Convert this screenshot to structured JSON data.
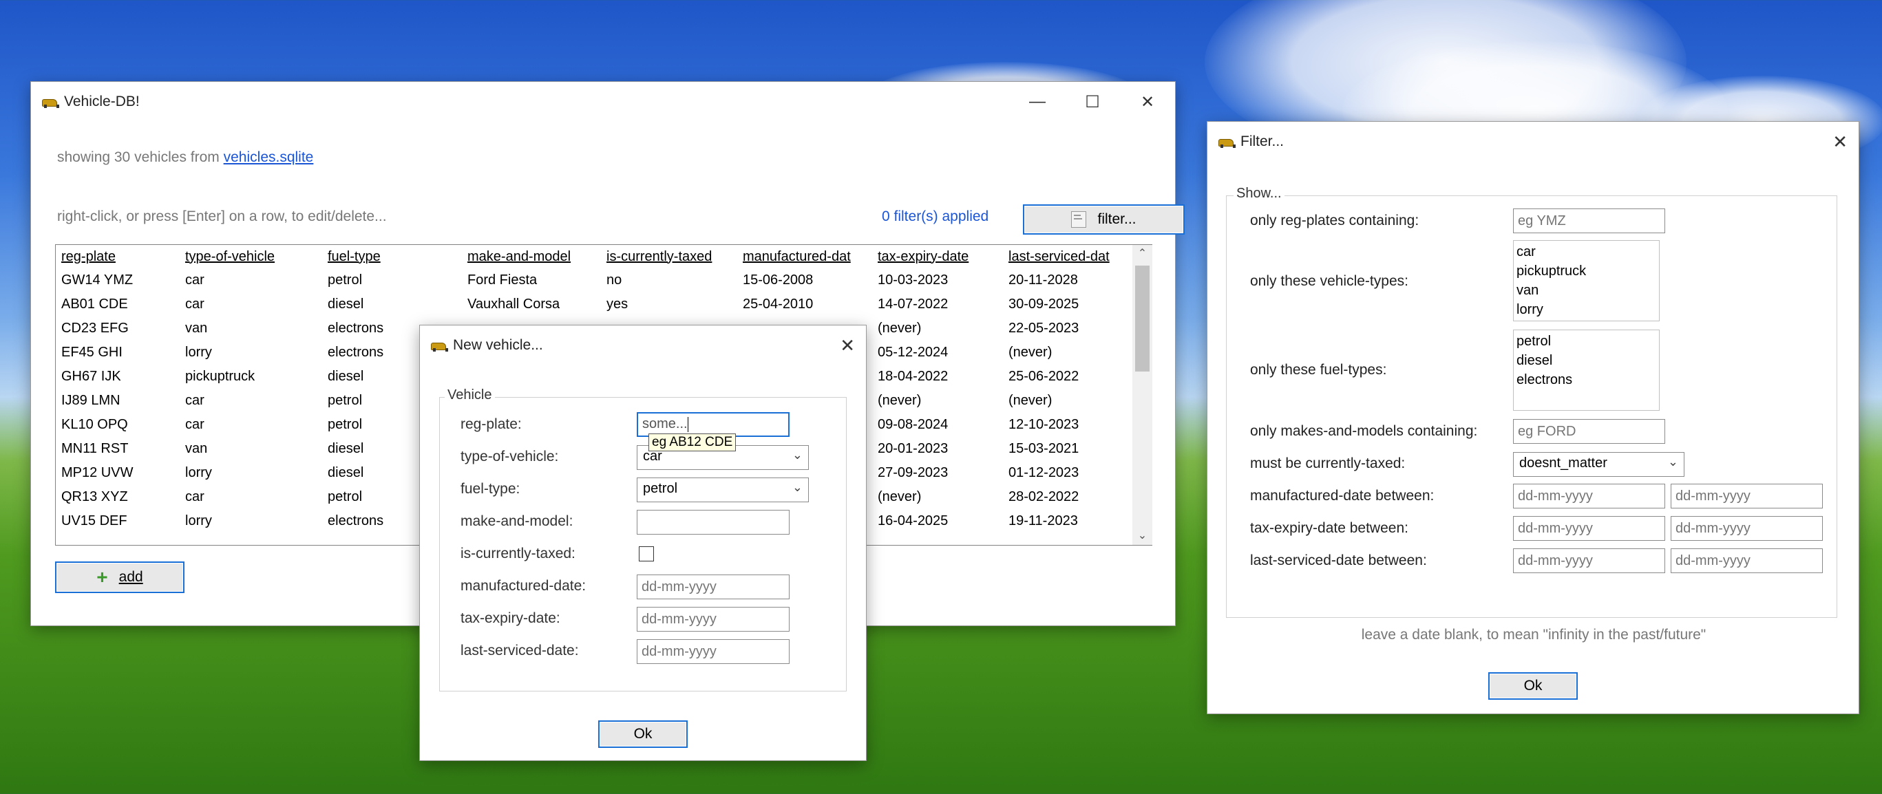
{
  "main": {
    "title": "Vehicle-DB!",
    "status_prefix": "showing 30 vehicles from",
    "status_link": "vehicles.sqlite",
    "hint": "right-click, or press [Enter] on a row, to edit/delete...",
    "filters_applied": "0 filter(s) applied",
    "filter_button": "filter...",
    "add_button": "add",
    "columns": [
      "reg-plate",
      "type-of-vehicle",
      "fuel-type",
      "make-and-model",
      "is-currently-taxed",
      "manufactured-dat",
      "tax-expiry-date",
      "last-serviced-dat"
    ],
    "rows": [
      [
        "GW14 YMZ",
        "car",
        "petrol",
        "Ford Fiesta",
        "no",
        "15-06-2008",
        "10-03-2023",
        "20-11-2028"
      ],
      [
        "AB01 CDE",
        "car",
        "diesel",
        "Vauxhall Corsa",
        "yes",
        "25-04-2010",
        "14-07-2022",
        "30-09-2025"
      ],
      [
        "CD23 EFG",
        "van",
        "electrons",
        "",
        "",
        "",
        "(never)",
        "22-05-2023"
      ],
      [
        "EF45 GHI",
        "lorry",
        "electrons",
        "",
        "",
        "",
        "05-12-2024",
        "(never)"
      ],
      [
        "GH67 IJK",
        "pickuptruck",
        "diesel",
        "",
        "",
        "",
        "18-04-2022",
        "25-06-2022"
      ],
      [
        "IJ89 LMN",
        "car",
        "petrol",
        "",
        "",
        "",
        "(never)",
        "(never)"
      ],
      [
        "KL10 OPQ",
        "car",
        "petrol",
        "",
        "",
        "",
        "09-08-2024",
        "12-10-2023"
      ],
      [
        "MN11 RST",
        "van",
        "diesel",
        "",
        "",
        "",
        "20-01-2023",
        "15-03-2021"
      ],
      [
        "MP12 UVW",
        "lorry",
        "diesel",
        "",
        "",
        "",
        "27-09-2023",
        "01-12-2023"
      ],
      [
        "QR13 XYZ",
        "car",
        "petrol",
        "",
        "",
        "",
        "(never)",
        "28-02-2022"
      ],
      [
        "UV15 DEF",
        "lorry",
        "electrons",
        "",
        "",
        "",
        "16-04-2025",
        "19-11-2023"
      ]
    ]
  },
  "newvehicle": {
    "title": "New vehicle...",
    "group": "Vehicle",
    "labels": {
      "reg": "reg-plate:",
      "type": "type-of-vehicle:",
      "fuel": "fuel-type:",
      "make": "make-and-model:",
      "taxed": "is-currently-taxed:",
      "manufactured": "manufactured-date:",
      "taxexpiry": "tax-expiry-date:",
      "serviced": "last-serviced-date:"
    },
    "reg_value": "some...",
    "reg_tooltip": "eg AB12 CDE",
    "type_value": "car",
    "fuel_value": "petrol",
    "date_placeholder": "dd-mm-yyyy",
    "ok": "Ok"
  },
  "filter": {
    "title": "Filter...",
    "group": "Show...",
    "labels": {
      "reg": "only reg-plates containing:",
      "types": "only these vehicle-types:",
      "fuels": "only these fuel-types:",
      "make": "only makes-and-models containing:",
      "taxed": "must be currently-taxed:",
      "manufactured": "manufactured-date between:",
      "taxexpiry": "tax-expiry-date between:",
      "serviced": "last-serviced-date between:"
    },
    "reg_placeholder": "eg YMZ",
    "vehicle_types": [
      "car",
      "pickuptruck",
      "van",
      "lorry"
    ],
    "fuel_types": [
      "petrol",
      "diesel",
      "electrons"
    ],
    "make_placeholder": "eg FORD",
    "taxed_value": "doesnt_matter",
    "date_placeholder": "dd-mm-yyyy",
    "footer": "leave a date blank, to mean \"infinity in the past/future\"",
    "ok": "Ok"
  }
}
